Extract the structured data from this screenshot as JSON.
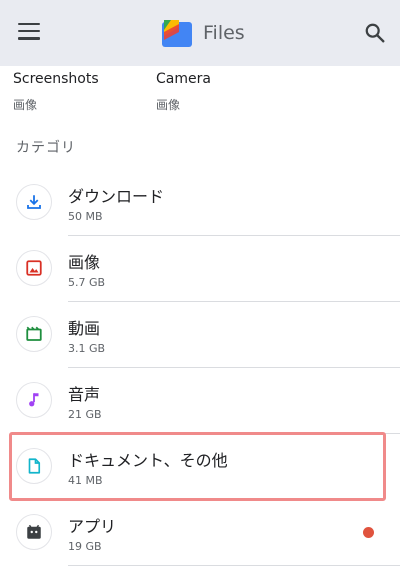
{
  "appbar": {
    "title": "Files"
  },
  "recent": [
    {
      "name": "Screenshots",
      "type": "画像"
    },
    {
      "name": "Camera",
      "type": "画像"
    }
  ],
  "section_title": "カテゴリ",
  "categories": [
    {
      "name": "ダウンロード",
      "size": "50 MB",
      "icon": "download-icon",
      "color": "#1a73e8"
    },
    {
      "name": "画像",
      "size": "5.7 GB",
      "icon": "image-icon",
      "color": "#d93025"
    },
    {
      "name": "動画",
      "size": "3.1 GB",
      "icon": "video-icon",
      "color": "#1e8e3e"
    },
    {
      "name": "音声",
      "size": "21 GB",
      "icon": "audio-icon",
      "color": "#a142f4"
    },
    {
      "name": "ドキュメント、その他",
      "size": "41 MB",
      "icon": "document-icon",
      "color": "#12b5cb"
    },
    {
      "name": "アプリ",
      "size": "19 GB",
      "icon": "android-app-icon",
      "color": "#3c4043"
    }
  ],
  "colors": {
    "appbar_bg": "#e9ebf1",
    "highlight": "#f08a8a",
    "notification_dot": "#e0533e"
  }
}
